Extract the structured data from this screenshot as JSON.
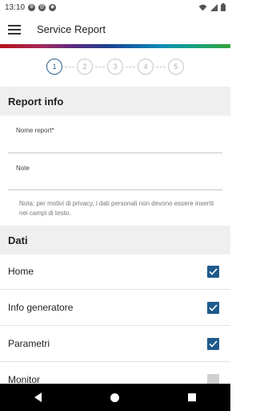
{
  "status": {
    "time": "13:10",
    "icons": [
      "gear-icon",
      "at-icon",
      "shield-icon"
    ],
    "right_icons": [
      "wifi-icon",
      "signal-icon",
      "battery-icon"
    ]
  },
  "appbar": {
    "title": "Service Report",
    "menu_icon": "hamburger-menu-icon"
  },
  "stepper": {
    "steps": [
      "1",
      "2",
      "3",
      "4",
      "5"
    ],
    "active_step": 1
  },
  "report_info": {
    "header": "Report info",
    "report_name_label": "Nome report*",
    "note_label": "Note",
    "privacy_note": "Nota: per motivi di privacy, i dati personali non devono essere inseriti nei campi di testo."
  },
  "dati": {
    "header": "Dati",
    "items": [
      {
        "label": "Home",
        "checked": true
      },
      {
        "label": "Info generatore",
        "checked": true
      },
      {
        "label": "Parametri",
        "checked": true
      },
      {
        "label": "Monitor",
        "checked": false
      }
    ]
  },
  "colors": {
    "accent": "#1f5a8c",
    "step_active": "#2d5d8a",
    "header_bg": "#efefef"
  },
  "navbar": {
    "icons": [
      "back-icon",
      "home-icon",
      "recents-icon"
    ]
  }
}
